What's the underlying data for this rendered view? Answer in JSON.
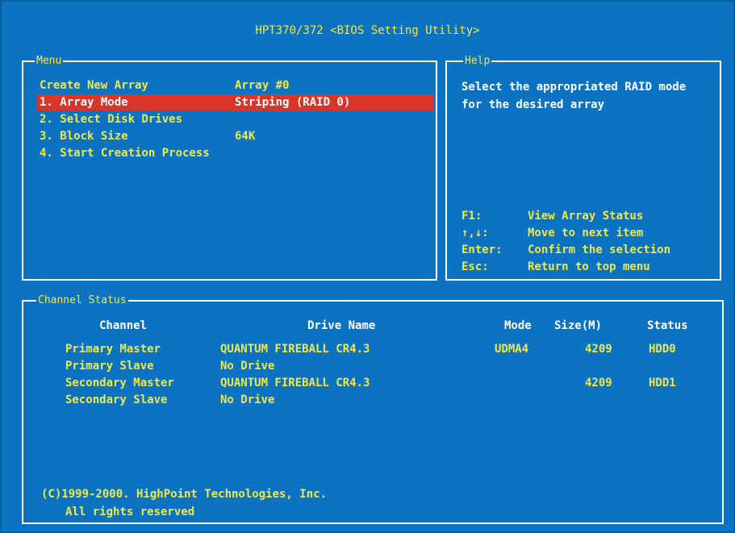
{
  "title": "HPT370/372 <BIOS Setting Utility>",
  "menu": {
    "panel_title": "Menu",
    "header_label": "Create New Array",
    "header_value": "Array #0",
    "items": [
      {
        "label": "1. Array Mode",
        "value": "Striping (RAID 0)",
        "selected": true
      },
      {
        "label": "2. Select Disk Drives",
        "value": ""
      },
      {
        "label": "3. Block Size",
        "value": "64K"
      },
      {
        "label": "4. Start Creation Process",
        "value": ""
      }
    ]
  },
  "help": {
    "panel_title": "Help",
    "text": "Select the appropriated RAID mode for the desired array",
    "keys": [
      {
        "key": "F1:",
        "desc": "View Array Status"
      },
      {
        "key": "↑,↓:",
        "desc": "Move to next item"
      },
      {
        "key": "Enter:",
        "desc": "Confirm the selection"
      },
      {
        "key": "Esc:",
        "desc": "Return to top menu"
      }
    ]
  },
  "channel": {
    "panel_title": "Channel Status",
    "headers": {
      "channel": "Channel",
      "drive": "Drive Name",
      "mode": "Mode",
      "size": "Size(M)",
      "status": "Status"
    },
    "rows": [
      {
        "channel": "Primary Master",
        "drive": "QUANTUM FIREBALL CR4.3",
        "mode": "UDMA4",
        "size": "4209",
        "status": "HDD0"
      },
      {
        "channel": "Primary Slave",
        "drive": "No Drive",
        "mode": "",
        "size": "",
        "status": ""
      },
      {
        "channel": "Secondary Master",
        "drive": "QUANTUM FIREBALL CR4.3",
        "mode": "",
        "size": "4209",
        "status": "HDD1"
      },
      {
        "channel": "Secondary Slave",
        "drive": "No Drive",
        "mode": "",
        "size": "",
        "status": ""
      }
    ],
    "copyright": "(C)1999-2000. HighPoint Technologies, Inc.",
    "rights": "All rights reserved"
  },
  "colors": {
    "background": "#0b73c2",
    "highlight": "#d8352a",
    "accent_text": "#f0e84a",
    "border": "#ffffff"
  }
}
